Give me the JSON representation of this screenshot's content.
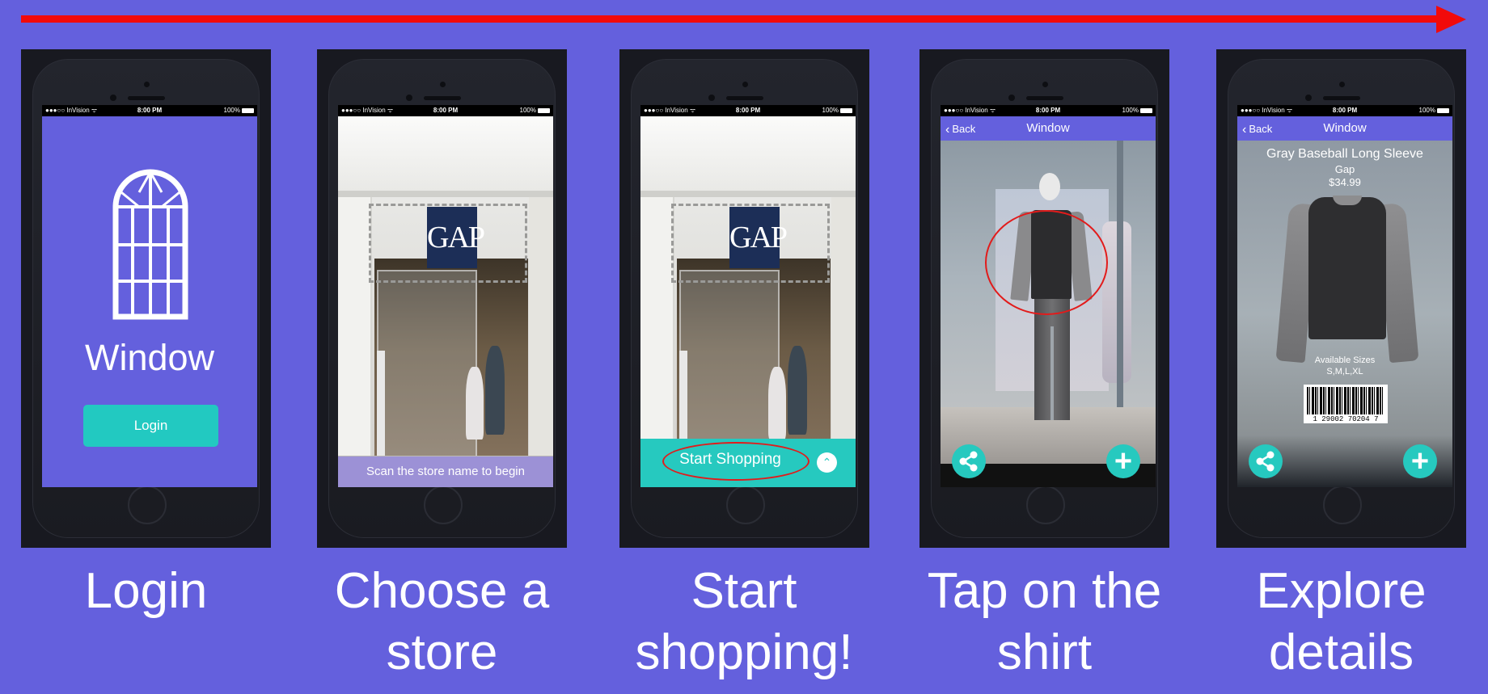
{
  "arrow": {
    "color": "#f20a0a"
  },
  "colors": {
    "background": "#6460dd",
    "accent": "#26c9bf",
    "highlight": "#e21b1b"
  },
  "statusbar": {
    "carrier": "●●●○○ InVision ᯤ",
    "time": "8:00 PM",
    "battery": "100%"
  },
  "steps": [
    {
      "caption_lines": [
        "Login"
      ]
    },
    {
      "caption_lines": [
        "Choose a",
        "store"
      ]
    },
    {
      "caption_lines": [
        "Start",
        "shopping!"
      ]
    },
    {
      "caption_lines": [
        "Tap on the",
        "shirt"
      ]
    },
    {
      "caption_lines": [
        "Explore",
        "details"
      ]
    }
  ],
  "login": {
    "app_name": "Window",
    "login_button": "Login"
  },
  "store": {
    "sign_text": "GAP",
    "scan_hint": "Scan the store name to begin",
    "start_button": "Start Shopping"
  },
  "nav": {
    "back_label": "Back",
    "title": "Window"
  },
  "product": {
    "name": "Gray Baseball Long Sleeve",
    "brand": "Gap",
    "price": "$34.99",
    "sizes_label": "Available Sizes",
    "sizes": "S,M,L,XL",
    "barcode": "1 29002 70204 7"
  },
  "icons": {
    "share": "share-icon",
    "add": "plus-icon",
    "back": "chevron-left-icon",
    "expand": "chevron-up-icon"
  }
}
